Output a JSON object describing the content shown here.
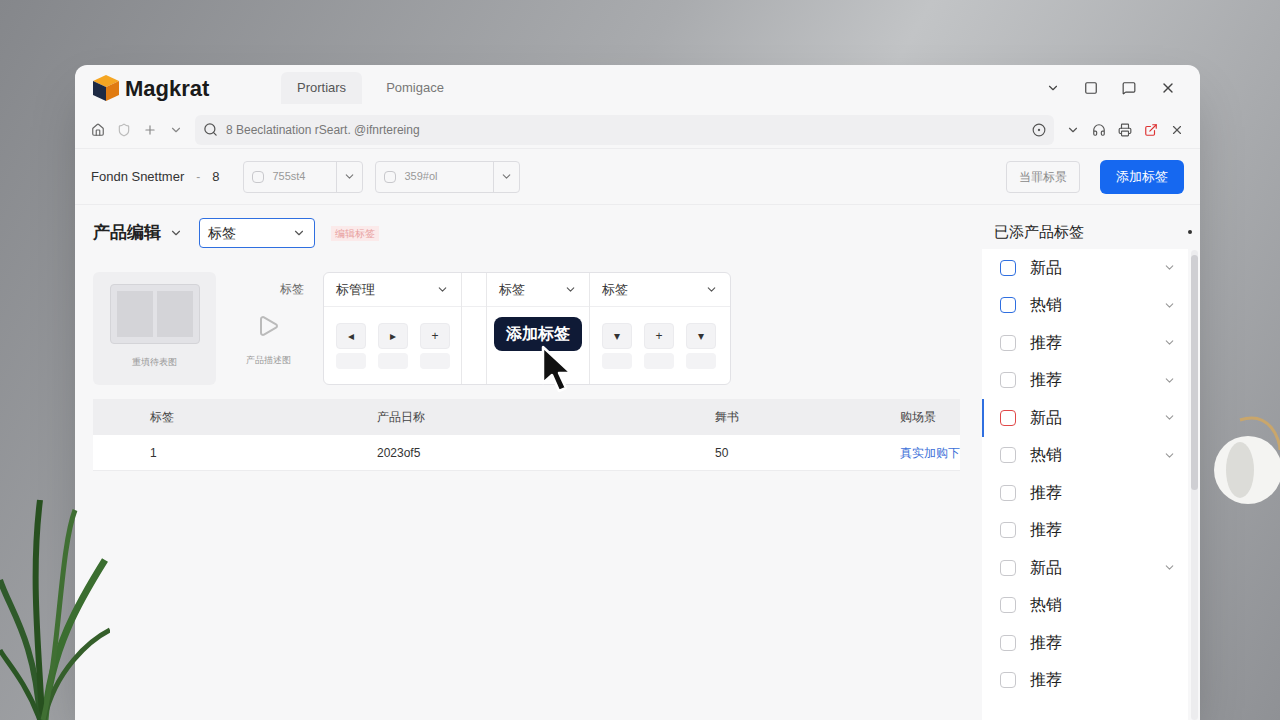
{
  "window": {
    "title": "Magkrat"
  },
  "tabs": [
    {
      "label": "Prortiars",
      "selected": true
    },
    {
      "label": "Pomigace",
      "selected": false
    }
  ],
  "address_bar": {
    "text": "8 Beeclatination rSeart. @ifnrtereing"
  },
  "toolbar": {
    "label": "Fondn Snettmer",
    "separator": "-",
    "count": "8",
    "filters": [
      {
        "value": "755st4",
        "checked": false
      },
      {
        "value": "359#ol",
        "checked": false
      }
    ],
    "buttons": [
      {
        "label": "当罪标景",
        "primary": false
      },
      {
        "label": "添加标签",
        "primary": true
      }
    ]
  },
  "editor": {
    "title": "产品编辑",
    "select": "标签",
    "hint": "编辑标签"
  },
  "media": {
    "thumbnail_caption": "重填待表图",
    "label": "标签",
    "video_caption": "产品描述图"
  },
  "control_groups": [
    {
      "kind": "buttons",
      "header": "标管理",
      "buttons": [
        "◂",
        "▸",
        "+"
      ]
    },
    {
      "kind": "spacer",
      "header": ""
    },
    {
      "kind": "action",
      "header": "标签",
      "action": "添加标签"
    },
    {
      "kind": "buttons",
      "header": "标签",
      "buttons": [
        "▾",
        "+",
        "▾"
      ]
    }
  ],
  "table": {
    "columns": [
      "标签",
      "产品日称",
      "舞书",
      "购场景"
    ],
    "rows": [
      [
        "1",
        "2023of5",
        "50",
        "真实加购下"
      ]
    ]
  },
  "sidebar": {
    "title": "已添产品标签",
    "items": [
      {
        "label": "新品",
        "checked": false,
        "color": "#2f6fe0",
        "selected": false,
        "expandable": true
      },
      {
        "label": "热销",
        "checked": false,
        "color": "#2f6fe0",
        "selected": false,
        "expandable": true
      },
      {
        "label": "推荐",
        "checked": false,
        "color": "#c8c8cc",
        "selected": false,
        "expandable": true
      },
      {
        "label": "推荐",
        "checked": false,
        "color": "#c8c8cc",
        "selected": false,
        "expandable": true
      },
      {
        "label": "新品",
        "checked": false,
        "color": "#e04848",
        "selected": true,
        "expandable": true
      },
      {
        "label": "热销",
        "checked": false,
        "color": "#c8c8cc",
        "selected": false,
        "expandable": true
      },
      {
        "label": "推荐",
        "checked": false,
        "color": "#c8c8cc",
        "selected": false,
        "expandable": false
      },
      {
        "label": "推荐",
        "checked": false,
        "color": "#c8c8cc",
        "selected": false,
        "expandable": false
      },
      {
        "label": "新品",
        "checked": false,
        "color": "#c8c8cc",
        "selected": false,
        "expandable": true
      },
      {
        "label": "热销",
        "checked": false,
        "color": "#c8c8cc",
        "selected": false,
        "expandable": false
      },
      {
        "label": "推荐",
        "checked": false,
        "color": "#c8c8cc",
        "selected": false,
        "expandable": false
      },
      {
        "label": "推荐",
        "checked": false,
        "color": "#c8c8cc",
        "selected": false,
        "expandable": false
      }
    ]
  }
}
